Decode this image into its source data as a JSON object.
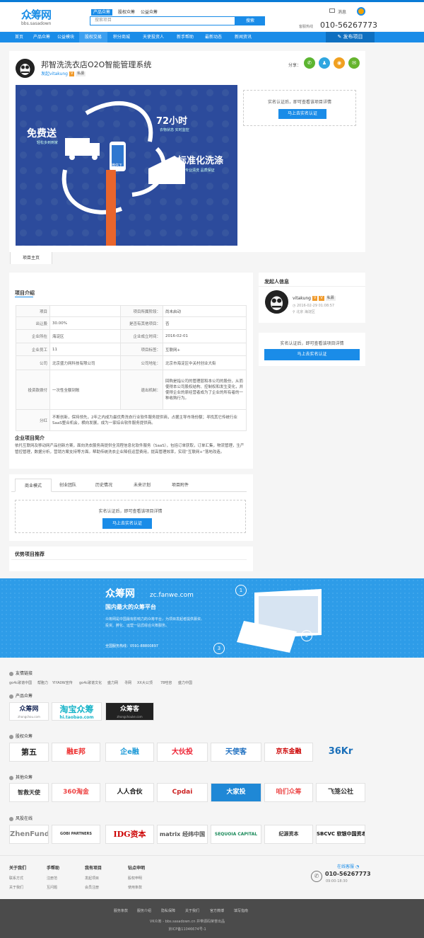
{
  "header": {
    "logo_text": "众筹网",
    "logo_domain": "bbs.sasadown",
    "search_tabs": [
      "产品众筹",
      "股权众筹",
      "公益众筹"
    ],
    "search_placeholder": "搜索项目",
    "search_button": "搜索",
    "message": "消息",
    "hotline_label": "客服热线",
    "hotline": "010-56267773"
  },
  "nav": {
    "items": [
      "首页",
      "产品众筹",
      "公益模块",
      "股权交易",
      "积分商城",
      "天使投资人",
      "新手帮助",
      "最新动态",
      "新闻资讯"
    ],
    "publish": "发布项目"
  },
  "project": {
    "title": "邦智洗洗衣店O2O智能管理系统",
    "publisher": "发起vitakung",
    "badge": "私募",
    "share_label": "分享：",
    "auth_text": "实名认证后，即可查看该项目详情",
    "auth_button": "马上去实名认证",
    "home_tab": "项目主页",
    "banner": {
      "free": "免费送",
      "free_sub": "轻松多到到家",
      "hours": "72小时",
      "hours_sub": "衣物状态 实时监控",
      "std": "标准化洗涤",
      "std_sub": "专业清洗 品质保证",
      "phone_text": "微信下单"
    }
  },
  "info": {
    "section_title": "项目介绍",
    "rows": [
      [
        "项目",
        "",
        "项目所属阶段：",
        "尚未启动"
      ],
      [
        "出让股",
        "30.00%",
        "是否有其他项目：",
        "否"
      ],
      [
        "企业所在",
        "海淀区",
        "企业成立时间：",
        "2016-02-01"
      ],
      [
        "企业员工",
        "11",
        "项目标签：",
        "互联网+"
      ],
      [
        "公司",
        "北京盛力网科技有限公司",
        "公司地址：",
        "北京市海淀区中关村创业大街"
      ],
      [
        "投资款拨付",
        "一次性全额到账",
        "退出机制：",
        "回购是指公司的管理层和本公司的股份，从而使得本公司股权结构、控制权和发生变化，并使得企业的原经营者成为了企业的所有者的一种收购行为。"
      ],
      [
        "分红",
        "不断创新，保持领先，2年之内成为最优秀洗衣行业软件服务提供商，占据主导市场份额；寻找其它传统行业SaaS整合机会，横向发展，成为一家综合软件服务提供商。"
      ]
    ],
    "company_title": "企业项目简介",
    "company_text": "依托互联网及移动网产品创新方案，面向洗衣服务商提供全流程信息化软件服务（SaaS），包括订单获取，订单汇集，物流管理，生产管控管理，数据分析，营销方案支持等方面。帮助传统洗衣企业降低运营费用，提高管理效率，实现“互联网+”落地改造。",
    "tabs": [
      "商业模式",
      "创业团队",
      "历史情况",
      "未来计划",
      "项目附件"
    ],
    "auth_text": "实名认证后，即可查看该项目详情",
    "auth_button": "马上去实名认证",
    "recommend_title": "优势项目推荐"
  },
  "sidebar": {
    "title": "发起人信息",
    "user": "vitakung",
    "badge": "私募",
    "time": "2016-02-29 01:08:57",
    "location": "北京 海淀区",
    "auth_text": "实名认证后，即可查看该项目详情",
    "auth_button": "马上去实名认证"
  },
  "promo": {
    "brand": "众筹网",
    "domain": "zc.fanwe.com",
    "slogan": "国内最大的众筹平台",
    "desc1": "众筹网是中国最有影响力的众筹平台，为项目发起者提供募资、",
    "desc2": "投资、孵化、运营一站式综合众筹服务。",
    "hotline": "全国服务热线：0591-88800897",
    "nums": [
      "1",
      "2",
      "3"
    ]
  },
  "partners": {
    "friend_title": "友情链接",
    "friend_links": [
      "go4c歌谱中国",
      "帮胞力",
      "YIYA0W宣传",
      "go4c歌谱文化",
      "盛力网",
      "寻网",
      "XX大公顶",
      "78哇容",
      "盛力中国"
    ],
    "product_title": "产品众筹",
    "product_logos": [
      "众筹网",
      "淘宝众筹",
      "众筹客"
    ],
    "product_sub": [
      "zhongchou.com",
      "hi.taobao.com",
      "zhongchouke.com"
    ],
    "equity_title": "股权众筹",
    "equity_logos": [
      "第五",
      "融E邦",
      "企e融",
      "大伙投",
      "天使客",
      "京东金融",
      "36Kr"
    ],
    "other_title": "其他众筹",
    "other_logos": [
      "智救天使",
      "360淘金",
      "人人合伙",
      "Cpdai",
      "大家投",
      "咱们众筹",
      "飞笼公社"
    ],
    "vc_title": "风投在线",
    "vc_logos": [
      "ZhenFund",
      "GOBI PARTNERS",
      "IDG资本",
      "matrix 经纬中国",
      "SEQUOIA CAPITAL",
      "纪源资本",
      "SBCVC 软银中国资本"
    ]
  },
  "footer": {
    "cols": [
      {
        "title": "关于我们",
        "links": [
          "联系方式",
          "关于我们"
        ]
      },
      {
        "title": "手帮助",
        "links": [
          "注册范",
          "互问题"
        ]
      },
      {
        "title": "我有项目",
        "links": [
          "发起项目",
          "会员注册"
        ]
      },
      {
        "title": "钻点申明",
        "links": [
          "股权申明",
          "使用条款"
        ]
      }
    ],
    "service": "在线客服",
    "phone": "010-56267773",
    "hours": "09:00-18:30",
    "bottom_links": [
      "服务条款",
      "服务介绍",
      "隐私保障",
      "关于我们",
      "官方微博",
      "填写指南"
    ],
    "copyright": "VK众筹 - bbs.sasadown.cn 并带源码荣誉出品",
    "icp": "京ICP备11046674号-1"
  },
  "colors": {
    "primary": "#1a8ce8",
    "nav": "#1a8ce8",
    "banner": "#2c4b9c",
    "promo": "#2e9ce8"
  }
}
